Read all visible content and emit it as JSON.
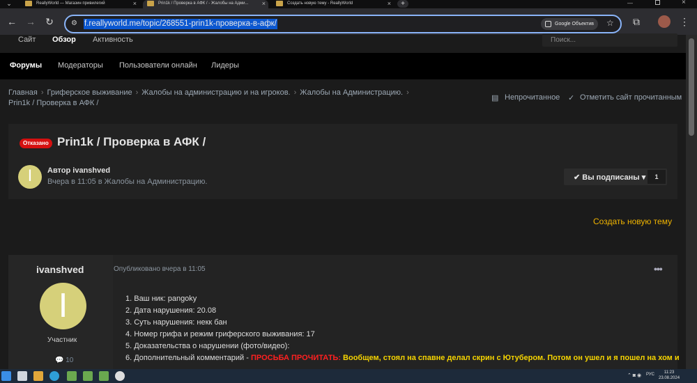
{
  "browser": {
    "tabs": [
      {
        "title": "ReallyWorld — Магазин привилегий"
      },
      {
        "title": "Prin1k / Проверка в АФК / - Жалобы на Адми..."
      },
      {
        "title": "Создать новую тему - ReallyWorld"
      }
    ],
    "url": "f.reallyworld.me/topic/268551-prin1k-проверка-в-афк/",
    "lens_label": "Google Объектив"
  },
  "site": {
    "subnav": [
      "Сайт",
      "Обзор",
      "Активность"
    ],
    "search_placeholder": "Поиск...",
    "mainnav": [
      "Форумы",
      "Модераторы",
      "Пользователи онлайн",
      "Лидеры"
    ],
    "breadcrumb": [
      "Главная",
      "Гриферское выживание",
      "Жалобы на администрацию и на игроков.",
      "Жалобы на Администрацию.",
      "Prin1k / Проверка в АФК /"
    ],
    "unread_label": "Непрочитанное",
    "mark_read_label": "Отметить сайт прочитанным"
  },
  "topic": {
    "status": "Отказано",
    "title": "Prin1k / Проверка в АФК /",
    "avatar_letter": "I",
    "author_line": "Автор ivanshved",
    "author_sub": "Вчера в 11:05 в Жалобы на Администрацию.",
    "follow_label": "Вы подписаны",
    "follow_count": "1",
    "create_topic": "Создать новую тему"
  },
  "post": {
    "author": "ivanshved",
    "avatar_letter": "I",
    "role": "Участник",
    "reputation": "10",
    "date": "Опубликовано вчера в 11:05",
    "more": "•••",
    "lines": [
      "1. Ваш ник:  pangoky",
      "2. Дата нарушения: 20.08",
      "3. Суть нарушения: некк бан",
      "4. Номер грифа и режим гриферского выживания: 17",
      "5. Доказательства о нарушении (фото/видео):"
    ],
    "line6_prefix": "6. Дополнительный комментарий - ",
    "line6_red": "ПРОСЬБА ПРОЧИТАТЬ:",
    "line6_yellow": " Вообщем, стоял на спавне делал скрин с Ютубером. Потом он ушел и я пошел на хом и"
  },
  "taskbar": {
    "lang": "РУС",
    "time": "11:23",
    "date": "23.08.2024"
  },
  "colors": {
    "accent": "#f0b400",
    "badge_red": "#d51010",
    "url_highlight": "#0b57d0",
    "avatar": "#d6d07a"
  }
}
